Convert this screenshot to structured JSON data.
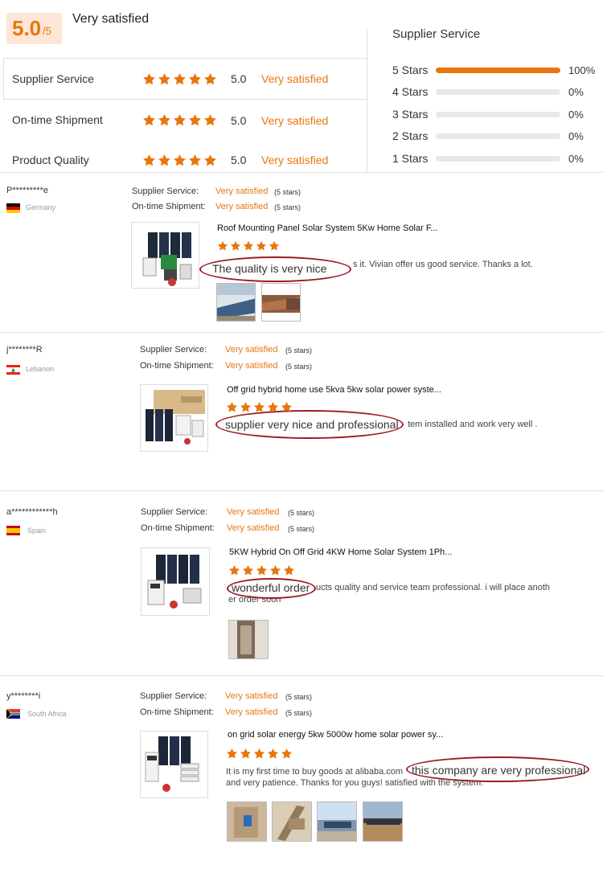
{
  "summary": {
    "score": "5.0",
    "denominator": "/5",
    "overall": "Very satisfied",
    "accent": "#e8760d",
    "ratings": [
      {
        "label": "Supplier Service",
        "score": "5.0",
        "text": "Very satisfied",
        "stars": 5
      },
      {
        "label": "On-time Shipment",
        "score": "5.0",
        "text": "Very satisfied",
        "stars": 5
      },
      {
        "label": "Product Quality",
        "score": "5.0",
        "text": "Very satisfied",
        "stars": 5
      }
    ]
  },
  "distribution": {
    "title": "Supplier Service",
    "rows": [
      {
        "label": "5 Stars",
        "pct": "100%",
        "fraction": 1.0
      },
      {
        "label": "4 Stars",
        "pct": "0%",
        "fraction": 0
      },
      {
        "label": "3 Stars",
        "pct": "0%",
        "fraction": 0
      },
      {
        "label": "2 Stars",
        "pct": "0%",
        "fraction": 0
      },
      {
        "label": "1 Stars",
        "pct": "0%",
        "fraction": 0
      }
    ]
  },
  "meta_labels": {
    "service": "Supplier Service:",
    "shipment": "On-time Shipment:"
  },
  "reviews": [
    {
      "user": "P*********e",
      "country": "Germany",
      "service": "Very satisfied",
      "service_stars": "(5 stars)",
      "shipment": "Very satisfied",
      "shipment_stars": "(5 stars)",
      "product": "Roof Mounting Panel Solar System 5Kw Home Solar F...",
      "stars": 5,
      "highlight": "The quality is very nice",
      "comment": "s it. Vivian offer us good service. Thanks a lot."
    },
    {
      "user": "j********R",
      "country": "Lebanon",
      "service": "Very satisfied",
      "service_stars": "(5 stars)",
      "shipment": "Very satisfied",
      "shipment_stars": "(5 stars)",
      "product": "Off grid hybrid home use 5kva 5kw solar power syste...",
      "stars": 5,
      "highlight": "supplier very nice and professional",
      "comment": "tem installed and work very well ."
    },
    {
      "user": "a************h",
      "country": "Spain",
      "service": "Very satisfied",
      "service_stars": "(5 stars)",
      "shipment": "Very satisfied",
      "shipment_stars": "(5 stars)",
      "product": "5KW Hybrid On Off Grid 4KW Home Solar System 1Ph...",
      "stars": 5,
      "highlight": "wonderful order",
      "comment": "ucts quality and service team professional. i will place anoth",
      "comment2": "er order soon"
    },
    {
      "user": "y********i",
      "country": "South Africa",
      "service": "Very satisfied",
      "service_stars": "(5 stars)",
      "shipment": "Very satisfied",
      "shipment_stars": "(5 stars)",
      "product": "on grid solar energy 5kw 5000w home solar power sy...",
      "stars": 5,
      "comment": "It is my first time to buy goods at alibaba.com",
      "highlight": "this company are very professional",
      "comment2": "and very patience. Thanks for you guys! satisfied with the system."
    }
  ]
}
